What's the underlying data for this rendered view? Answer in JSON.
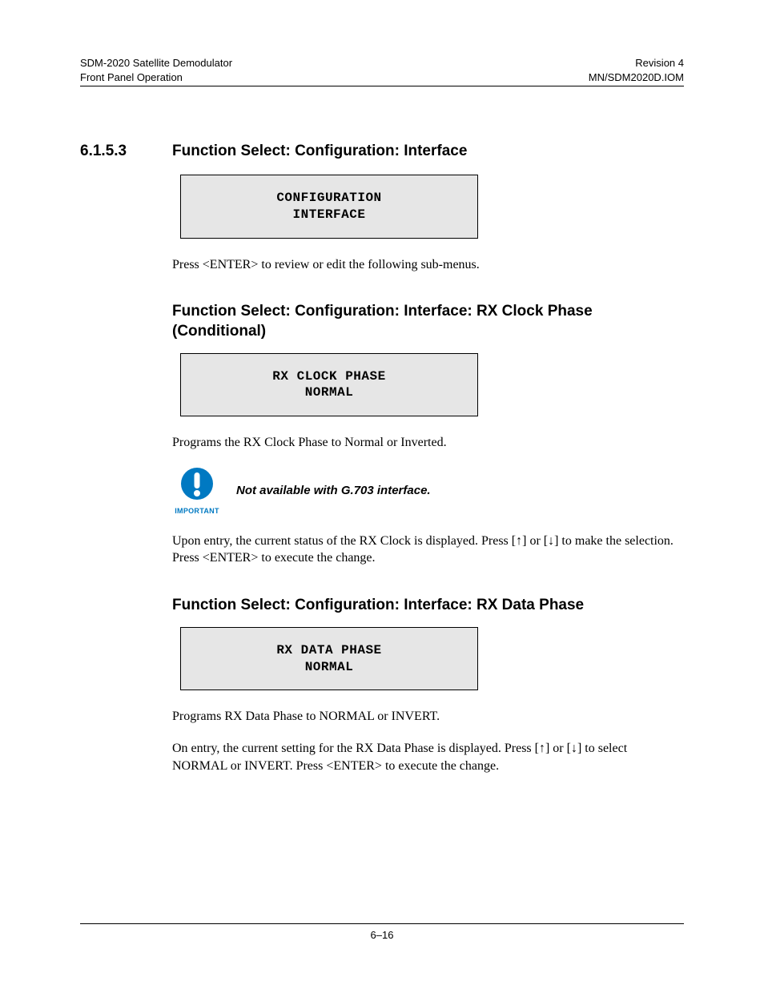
{
  "header": {
    "left_line1": "SDM-2020 Satellite Demodulator",
    "left_line2": "Front Panel Operation",
    "right_line1": "Revision 4",
    "right_line2": "MN/SDM2020D.IOM"
  },
  "section": {
    "number": "6.1.5.3",
    "title": "Function Select: Configuration: Interface",
    "lcd_line1": "CONFIGURATION",
    "lcd_line2": "INTERFACE",
    "body": "Press <ENTER> to review or edit the following sub-menus."
  },
  "sub1": {
    "title": "Function Select: Configuration: Interface: RX Clock Phase (Conditional)",
    "lcd_line1": "RX CLOCK PHASE",
    "lcd_line2": "NORMAL",
    "body1": "Programs the RX Clock Phase to Normal or Inverted.",
    "important_label": "IMPORTANT",
    "important_text": "Not available with G.703 interface.",
    "body2_a": "Upon entry, the current status of the RX Clock is displayed. Press [",
    "body2_b": "] or [",
    "body2_c": "] to make the selection. Press <ENTER> to execute the change.",
    "arrow_up": "↑",
    "arrow_down": "↓"
  },
  "sub2": {
    "title": "Function Select: Configuration: Interface: RX Data Phase",
    "lcd_line1": "RX DATA PHASE",
    "lcd_line2": "NORMAL",
    "body1": "Programs RX Data Phase to NORMAL or INVERT.",
    "body2_a": "On entry, the current setting for the RX Data Phase is displayed. Press [",
    "body2_b": "] or [",
    "body2_c": "] to select NORMAL or INVERT. Press <ENTER> to execute the change.",
    "arrow_up": "↑",
    "arrow_down": "↓"
  },
  "footer": {
    "page": "6–16"
  }
}
